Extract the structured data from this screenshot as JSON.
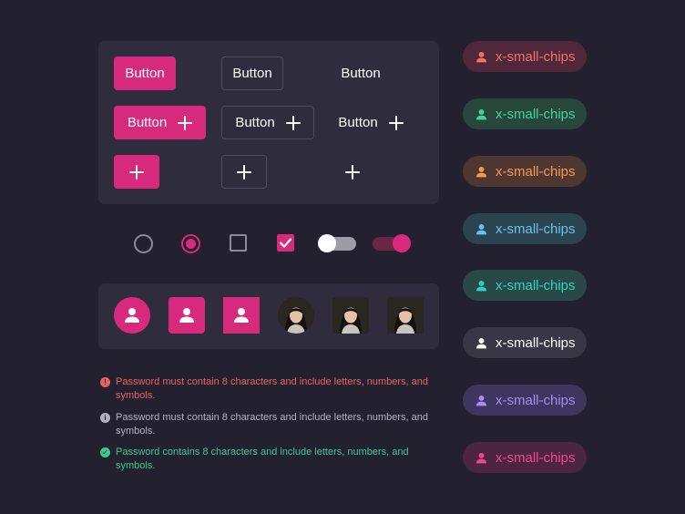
{
  "buttons": {
    "label": "Button"
  },
  "controls": {
    "radio_unchecked": "unchecked",
    "radio_checked": "checked",
    "checkbox_unchecked": "unchecked",
    "checkbox_checked": "checked",
    "switch_off": "off",
    "switch_on": "on"
  },
  "messages": [
    {
      "text": "Password must contain 8 characters and include letters, numbers, and symbols.",
      "color": "#e8635f",
      "icon": "error-icon"
    },
    {
      "text": "Password must contain 8 characters and include letters, numbers, and symbols.",
      "color": "#b4b1bf",
      "icon": "info-icon"
    },
    {
      "text": "Password contains 8 characters and include letters, numbers, and symbols.",
      "color": "#3dc98a",
      "icon": "success-icon"
    }
  ],
  "chips": [
    {
      "label": "x-small-chips",
      "bg": "#51273a",
      "fg": "#f07268",
      "icon": "person-icon"
    },
    {
      "label": "x-small-chips",
      "bg": "#27473d",
      "fg": "#46d39a",
      "icon": "person-icon"
    },
    {
      "label": "x-small-chips",
      "bg": "#4d3730",
      "fg": "#f59a55",
      "icon": "person-icon"
    },
    {
      "label": "x-small-chips",
      "bg": "#2b4550",
      "fg": "#6cc0ef",
      "icon": "person-icon"
    },
    {
      "label": "x-small-chips",
      "bg": "#28484a",
      "fg": "#2fd4b8",
      "icon": "person-icon"
    },
    {
      "label": "x-small-chips",
      "bg": "#393745",
      "fg": "#ffffff",
      "icon": "person-icon"
    },
    {
      "label": "x-small-chips",
      "bg": "#3e3560",
      "fg": "#a98df2",
      "icon": "person-icon"
    },
    {
      "label": "x-small-chips",
      "bg": "#4c2540",
      "fg": "#f0478e",
      "icon": "person-icon"
    }
  ],
  "colors": {
    "accent": "#d82a7d",
    "background": "#232130",
    "panel": "#2f2c3e"
  }
}
